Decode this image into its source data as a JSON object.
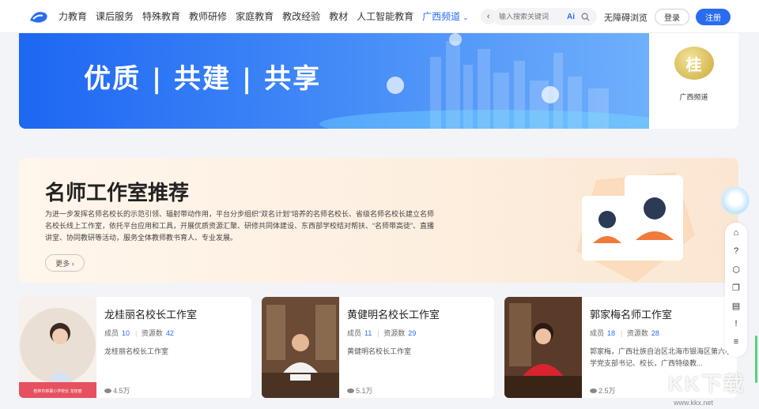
{
  "nav": {
    "items": [
      "力教育",
      "课后服务",
      "特殊教育",
      "教师研修",
      "家庭教育",
      "教改经验",
      "教材",
      "人工智能教育"
    ],
    "active": "广西频道",
    "prev": "‹",
    "next": "›"
  },
  "search": {
    "placeholder": "输入搜索关键词",
    "ai": "Ai"
  },
  "header": {
    "accessibility": "无障碍浏览",
    "login": "登录",
    "register": "注册"
  },
  "banner": {
    "slogan": "优质 | 共建 | 共享",
    "side_badge": "桂",
    "side_label": "广西频道"
  },
  "promo": {
    "title": "名师工作室推荐",
    "desc": "为进一步发挥名师名校长的示范引领、辐射带动作用，平台分步组织“双名计划”培养的名师名校长、省级名师名校长建立名师名校长线上工作室，依托平台应用和工具，开展优质资源汇聚、研修共同体建设、东西部学校结对帮扶、“名师带高徒”、直播讲堂、协同教研等活动，服务全体教师教书育人、专业发展。",
    "more": "更多 ›"
  },
  "cards": [
    {
      "title": "龙桂丽名校长工作室",
      "members_label": "成员",
      "members": "10",
      "resources_label": "资源数",
      "resources": "42",
      "desc": "龙桂丽名校长工作室",
      "views": "4.5万",
      "caption": "桂林市林寨小学校长  龙桂丽"
    },
    {
      "title": "黄健明名校长工作室",
      "members_label": "成员",
      "members": "11",
      "resources_label": "资源数",
      "resources": "29",
      "desc": "黄健明名校长工作室",
      "views": "5.1万"
    },
    {
      "title": "郭家梅名师工作室",
      "members_label": "成员",
      "members": "18",
      "resources_label": "资源数",
      "resources": "28",
      "desc": "郭家梅，广西壮族自治区北海市银海区第六小学党支部书记、校长，广西特级教...",
      "views": "2.5万"
    }
  ],
  "watermark": {
    "text": "KK下载",
    "url": "www.kkx.net"
  },
  "colors": {
    "accent": "#2a6cf0",
    "banner": "#1d67f2",
    "promo_bg": "#fdefe0"
  }
}
